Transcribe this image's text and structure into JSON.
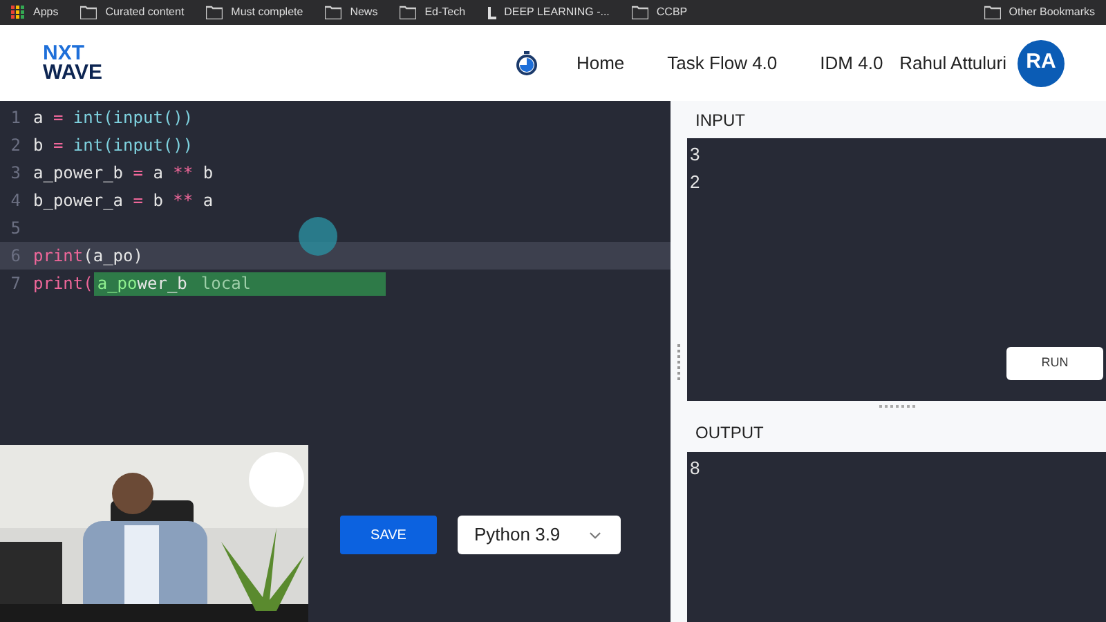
{
  "bookmarks": [
    {
      "label": "Apps",
      "kind": "apps"
    },
    {
      "label": "Curated content",
      "kind": "folder"
    },
    {
      "label": "Must complete",
      "kind": "folder"
    },
    {
      "label": "News",
      "kind": "folder"
    },
    {
      "label": "Ed-Tech",
      "kind": "folder"
    },
    {
      "label": "DEEP LEARNING -...",
      "kind": "site"
    },
    {
      "label": "CCBP",
      "kind": "folder"
    }
  ],
  "other_bookmarks": "Other Bookmarks",
  "header": {
    "logo": [
      "NXT",
      "WAVE"
    ],
    "nav": [
      "Home",
      "Task Flow 4.0",
      "IDM 4.0"
    ],
    "user_name": "Rahul Attuluri",
    "avatar": "RA"
  },
  "editor": {
    "lines": [
      {
        "number": "1",
        "active": false,
        "tokens": [
          {
            "t": "a ",
            "kind": "var"
          },
          {
            "t": "=",
            "kind": "op"
          },
          {
            "t": " int(input())",
            "kind": "builtin"
          }
        ]
      },
      {
        "number": "2",
        "active": false,
        "tokens": [
          {
            "t": "b ",
            "kind": "var"
          },
          {
            "t": "=",
            "kind": "op"
          },
          {
            "t": " int(input())",
            "kind": "builtin"
          }
        ]
      },
      {
        "number": "3",
        "active": false,
        "tokens": [
          {
            "t": "a_power_b ",
            "kind": "var"
          },
          {
            "t": "=",
            "kind": "op"
          },
          {
            "t": " a ",
            "kind": "var"
          },
          {
            "t": "**",
            "kind": "op"
          },
          {
            "t": " b",
            "kind": "var"
          }
        ]
      },
      {
        "number": "4",
        "active": false,
        "tokens": [
          {
            "t": "b_power_a ",
            "kind": "var"
          },
          {
            "t": "=",
            "kind": "op"
          },
          {
            "t": " b ",
            "kind": "var"
          },
          {
            "t": "**",
            "kind": "op"
          },
          {
            "t": " a",
            "kind": "var"
          }
        ]
      },
      {
        "number": "5",
        "active": false
      },
      {
        "number": "6",
        "active": true,
        "tokens": [
          {
            "t": "print",
            "kind": "keyword"
          },
          {
            "t": "(a_po",
            "kind": "var"
          },
          {
            "t": ")",
            "kind": "var"
          }
        ]
      },
      {
        "number": "7",
        "active": false,
        "tokens": [
          {
            "t": "print(",
            "kind": "keyword"
          }
        ]
      }
    ],
    "autocomplete": {
      "match": "a_po",
      "rest": "wer_b",
      "type": "local"
    }
  },
  "save_button": "SAVE",
  "language": "Python 3.9",
  "input": {
    "label": "INPUT",
    "lines": [
      "3",
      "2"
    ],
    "run_button": "RUN"
  },
  "output": {
    "label": "OUTPUT",
    "lines": [
      "8"
    ]
  }
}
